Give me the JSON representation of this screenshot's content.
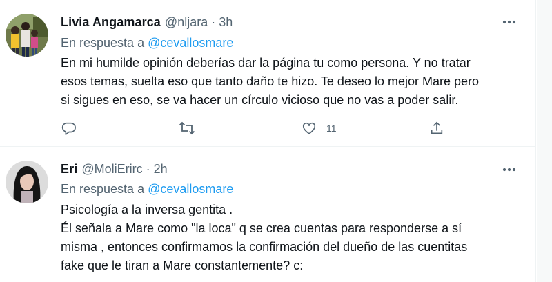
{
  "tweets": [
    {
      "author_name": "Livia Angamarca",
      "author_handle": "@nljara",
      "separator": "·",
      "time": "3h",
      "reply_prefix": "En respuesta a",
      "reply_mention": "@cevallosmare",
      "body_lines": [
        "En mi humilde opinión deberías dar la página tu como persona. Y no tratar",
        "esos temas, suelta eso que tanto daño te hizo. Te deseo lo mejor Mare pero",
        "si sigues en eso, se va hacer un círculo vicioso que no vas a poder salir."
      ],
      "actions": {
        "reply_icon": "reply-icon",
        "retweet_icon": "retweet-icon",
        "like_icon": "heart-icon",
        "like_count": "11",
        "share_icon": "share-icon"
      }
    },
    {
      "author_name": "Eri",
      "author_handle": "@MoliErirc",
      "separator": "·",
      "time": "2h",
      "reply_prefix": "En respuesta a",
      "reply_mention": "@cevallosmare",
      "body_lines": [
        "Psicología a la inversa gentita .",
        "Él señala a Mare como \"la loca\" q se crea cuentas para responderse a sí",
        "misma , entonces confirmamos la confirmación del dueño de las cuentitas",
        "fake que le tiran a Mare constantemente? c:"
      ]
    }
  ],
  "colors": {
    "text_primary": "#0f1419",
    "text_secondary": "#536471",
    "accent_blue": "#1d9bf0",
    "divider": "#eff3f4"
  },
  "icons": {
    "more": "more-horizontal-icon"
  }
}
